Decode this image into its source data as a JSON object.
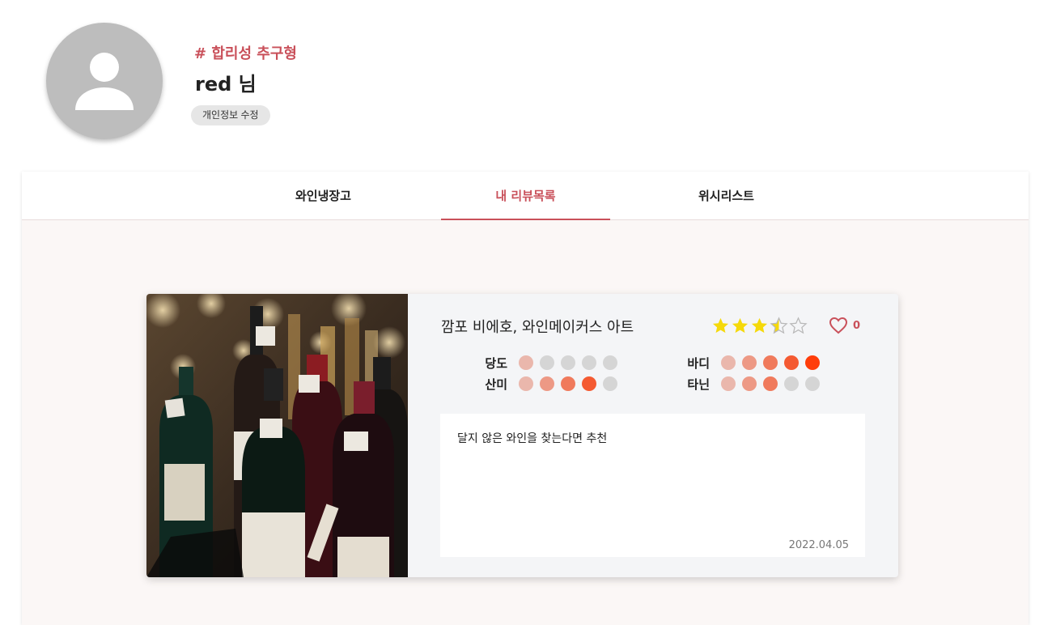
{
  "profile": {
    "taste_tag": "# 합리성 추구형",
    "username": "red 님",
    "edit_button": "개인정보 수정",
    "avatar_icon": "person-icon"
  },
  "tabs": [
    {
      "label": "와인냉장고",
      "active": false
    },
    {
      "label": "내 리뷰목록",
      "active": true
    },
    {
      "label": "위시리스트",
      "active": false
    }
  ],
  "review": {
    "wine_name": "깜포 비에호, 와인메이커스 아트",
    "rating": 3.5,
    "rating_max": 5,
    "likes": "0",
    "attributes": [
      {
        "label": "당도",
        "level": 1
      },
      {
        "label": "바디",
        "level": 5
      },
      {
        "label": "산미",
        "level": 4
      },
      {
        "label": "타닌",
        "level": 3
      }
    ],
    "text": "달지 않은 와인을 찾는다면 추천",
    "date": "2022.04.05"
  },
  "colors": {
    "accent": "#c9505a",
    "star": "#f5d90a",
    "dot_levels": [
      "#eab7ac",
      "#ed9985",
      "#f07a5c",
      "#f45a32",
      "#ff3d0a"
    ],
    "dot_empty": "#d5d5d5"
  }
}
